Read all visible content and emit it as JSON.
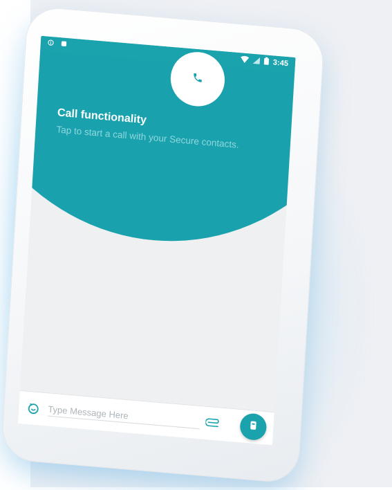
{
  "status_bar": {
    "left_icons": [
      "info-icon",
      "notification-icon"
    ],
    "right_icons": [
      "wifi-icon",
      "signal-icon",
      "battery-icon"
    ],
    "time": "3:45"
  },
  "onboarding": {
    "icon": "phone-icon",
    "title": "Call functionality",
    "description": "Tap to start a call with your Secure contacts."
  },
  "composer": {
    "emoji_icon": "emoji-icon",
    "placeholder": "Type Message Here",
    "value": "",
    "attach_icon": "attachment-icon",
    "send_icon": "send-icon"
  },
  "colors": {
    "accent": "#19a2ad",
    "background": "#eef0f4"
  }
}
